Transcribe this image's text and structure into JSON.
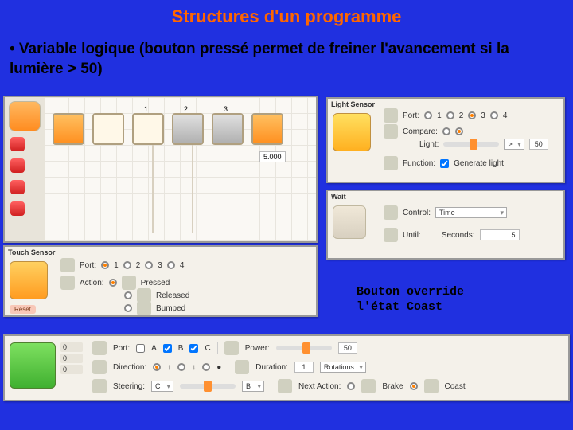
{
  "title": "Structures d'un programme",
  "bullet": "• Variable logique (bouton pressé  permet de freiner l'avancement si la lumière > 50)",
  "caption_line1": "Bouton override",
  "caption_line2": "l'état Coast",
  "canvas": {
    "block_labels": {
      "n1": "1",
      "n2": "2",
      "n3": "3"
    },
    "readout": "5.000"
  },
  "touch": {
    "title": "Touch Sensor",
    "tab": "Reset",
    "port_label": "Port:",
    "ports": {
      "p1": "1",
      "p2": "2",
      "p3": "3",
      "p4": "4"
    },
    "action_label": "Action:",
    "opts": {
      "pressed": "Pressed",
      "released": "Released",
      "bumped": "Bumped"
    }
  },
  "light": {
    "title": "Light Sensor",
    "port_label": "Port:",
    "ports": {
      "p1": "1",
      "p2": "2",
      "p3": "3",
      "p4": "4"
    },
    "compare_label": "Compare:",
    "light_label": "Light:",
    "op": ">",
    "val": "50",
    "func_label": "Function:",
    "func_opt": "Generate light"
  },
  "wait": {
    "title": "Wait",
    "control_label": "Control:",
    "control_val": "Time",
    "until_label": "Until:",
    "seconds_label": "Seconds:",
    "seconds_val": "5"
  },
  "move": {
    "readouts": {
      "a": "0",
      "b": "0",
      "c": "0"
    },
    "port_label": "Port:",
    "ports": {
      "a": "A",
      "b": "B",
      "c": "C"
    },
    "power_label": "Power:",
    "power_val": "50",
    "dir_label": "Direction:",
    "dur_label": "Duration:",
    "dur_val": "1",
    "dur_unit": "Rotations",
    "steer_label": "Steering:",
    "steer_left": "C",
    "steer_right": "B",
    "next_label": "Next Action:",
    "brake": "Brake",
    "coast": "Coast"
  }
}
